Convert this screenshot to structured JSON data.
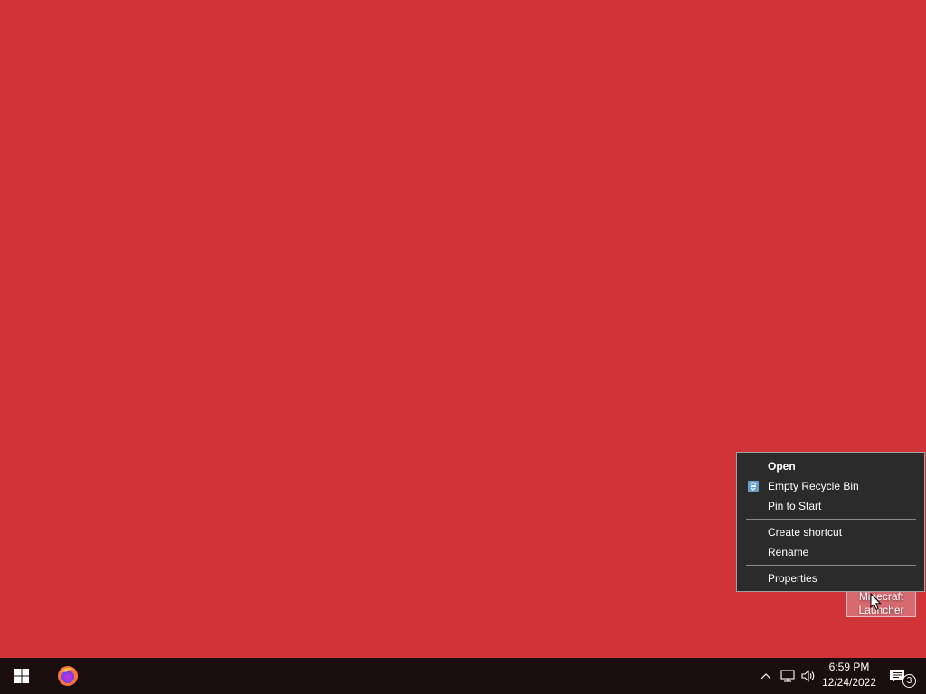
{
  "desktop": {
    "background_color": "#d03438",
    "icon": {
      "label_line1": "Minecraft",
      "label_line2": "Launcher"
    }
  },
  "context_menu": {
    "items": [
      {
        "label": "Open",
        "bold": true
      },
      {
        "label": "Empty Recycle Bin",
        "icon": "recycle-bin-icon"
      },
      {
        "label": "Pin to Start"
      },
      {
        "label": "Create shortcut"
      },
      {
        "label": "Rename"
      },
      {
        "label": "Properties"
      }
    ]
  },
  "taskbar": {
    "start_icon": "windows-logo-icon",
    "pinned_app": "firefox-icon",
    "tray_icons": [
      "chevron-up-icon",
      "network-icon",
      "volume-icon"
    ],
    "clock": {
      "time": "6:59 PM",
      "date": "12/24/2022"
    },
    "notifications": {
      "count": "3",
      "icon": "action-center-icon"
    }
  }
}
